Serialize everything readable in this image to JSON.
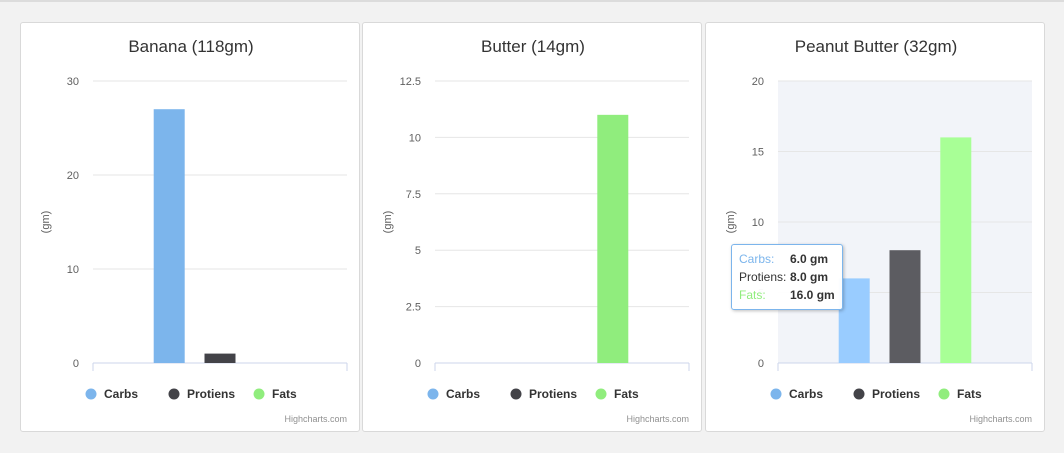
{
  "credit_text": "Highcharts.com",
  "legend": [
    {
      "name": "Carbs",
      "color": "#7cb5ec"
    },
    {
      "name": "Protiens",
      "color": "#434348"
    },
    {
      "name": "Fats",
      "color": "#90ed7d"
    }
  ],
  "chart_data": [
    {
      "type": "bar",
      "title": "Banana (118gm)",
      "ylabel": "(gm)",
      "ylim": [
        0,
        30
      ],
      "yticks": [
        "0",
        "10",
        "20",
        "30"
      ],
      "series": [
        {
          "name": "Carbs",
          "values": [
            27
          ],
          "color": "#7cb5ec"
        },
        {
          "name": "Protiens",
          "values": [
            1
          ],
          "color": "#434348"
        },
        {
          "name": "Fats",
          "values": [
            0
          ],
          "color": "#90ed7d"
        }
      ]
    },
    {
      "type": "bar",
      "title": "Butter (14gm)",
      "ylabel": "(gm)",
      "ylim": [
        0,
        12.5
      ],
      "yticks": [
        "0",
        "2.5",
        "5",
        "7.5",
        "10",
        "12.5"
      ],
      "series": [
        {
          "name": "Carbs",
          "values": [
            0
          ],
          "color": "#7cb5ec"
        },
        {
          "name": "Protiens",
          "values": [
            0
          ],
          "color": "#434348"
        },
        {
          "name": "Fats",
          "values": [
            11
          ],
          "color": "#90ed7d"
        }
      ]
    },
    {
      "type": "bar",
      "title": "Peanut Butter (32gm)",
      "ylabel": "(gm)",
      "ylim": [
        0,
        20
      ],
      "yticks": [
        "0",
        "5",
        "10",
        "15",
        "20"
      ],
      "hover": true,
      "series": [
        {
          "name": "Carbs",
          "values": [
            6
          ],
          "color": "#7cb5ec"
        },
        {
          "name": "Protiens",
          "values": [
            8
          ],
          "color": "#434348"
        },
        {
          "name": "Fats",
          "values": [
            16
          ],
          "color": "#90ed7d"
        }
      ],
      "tooltip": {
        "rows": [
          {
            "label": "Carbs:",
            "value": "6.0 gm",
            "color": "#7cb5ec"
          },
          {
            "label": "Protiens:",
            "value": "8.0 gm",
            "color": "#333333"
          },
          {
            "label": "Fats:",
            "value": "16.0 gm",
            "color": "#90ed7d"
          }
        ]
      }
    }
  ]
}
